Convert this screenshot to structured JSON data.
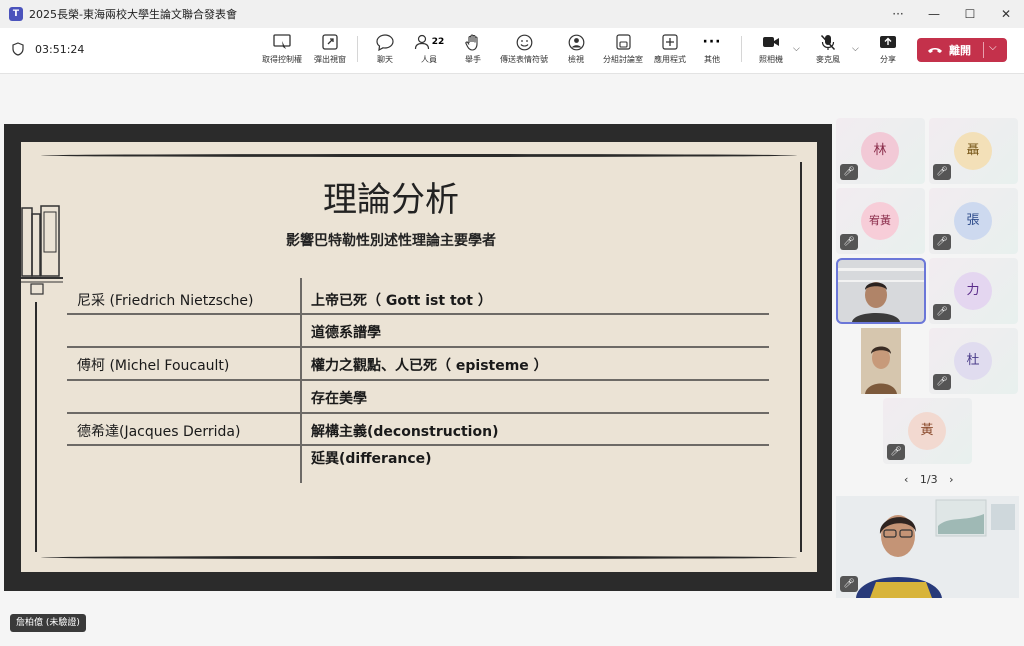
{
  "window": {
    "title": "2025長榮-東海兩校大學生論文聯合發表會",
    "controls": [
      "···",
      "—",
      "☐",
      "✕"
    ]
  },
  "meeting": {
    "timer": "03:51:24"
  },
  "toolbar": {
    "take_control": "取得控制權",
    "pop_out": "彈出視窗",
    "chat": "聊天",
    "people": "人員",
    "people_count": "22",
    "raise_hand": "舉手",
    "reactions": "傳送表情符號",
    "view": "檢視",
    "rooms": "分組討論室",
    "apps": "應用程式",
    "more": "其他",
    "camera": "照相機",
    "mic": "麥克風",
    "share": "分享",
    "leave": "離開"
  },
  "slide": {
    "title": "理論分析",
    "subtitle": "影響巴特勒性別述性理論主要學者",
    "rows": [
      {
        "c1": "尼采 (Friedrich Nietzsche)",
        "c2": "上帝已死（ Gott ist tot ）"
      },
      {
        "c1": "",
        "c2": "道德系譜學"
      },
      {
        "c1": "傅柯 (Michel Foucault)",
        "c2": "權力之觀點、人已死（ episteme ）"
      },
      {
        "c1": "",
        "c2": "存在美學"
      },
      {
        "c1": "德希達(Jacques Derrida)",
        "c2": "解構主義(deconstruction)"
      },
      {
        "c1": "",
        "c2": "延異(differance)"
      }
    ]
  },
  "participants": [
    {
      "initial": "林",
      "color": "#f2c9d6"
    },
    {
      "initial": "聶",
      "color": "#f3e0b8"
    },
    {
      "initial": "宥黃",
      "color": "#f7cdd8"
    },
    {
      "initial": "張",
      "color": "#cdd9ef"
    },
    {
      "initial": "",
      "color": "#dfe3ea"
    },
    {
      "initial": "力",
      "color": "#e4d6f0"
    },
    {
      "initial": "",
      "color": "#c9b9a6"
    },
    {
      "initial": "杜",
      "color": "#e0dcef"
    },
    {
      "initial": "黃",
      "color": "#f2d9d0"
    }
  ],
  "pager": {
    "text": "1/3"
  },
  "presenter": {
    "name": "詹柏億 (未驗證)"
  },
  "icons": [
    "teams-icon",
    "shield-icon",
    "take-control-icon",
    "pop-out-icon",
    "chat-icon",
    "people-icon",
    "hand-icon",
    "emoji-icon",
    "view-icon",
    "rooms-icon",
    "apps-icon",
    "more-icon",
    "camera-icon",
    "mic-off-icon",
    "share-icon",
    "phone-icon"
  ],
  "colors": {
    "leave": "#c4314b",
    "accent": "#6b77d8"
  }
}
